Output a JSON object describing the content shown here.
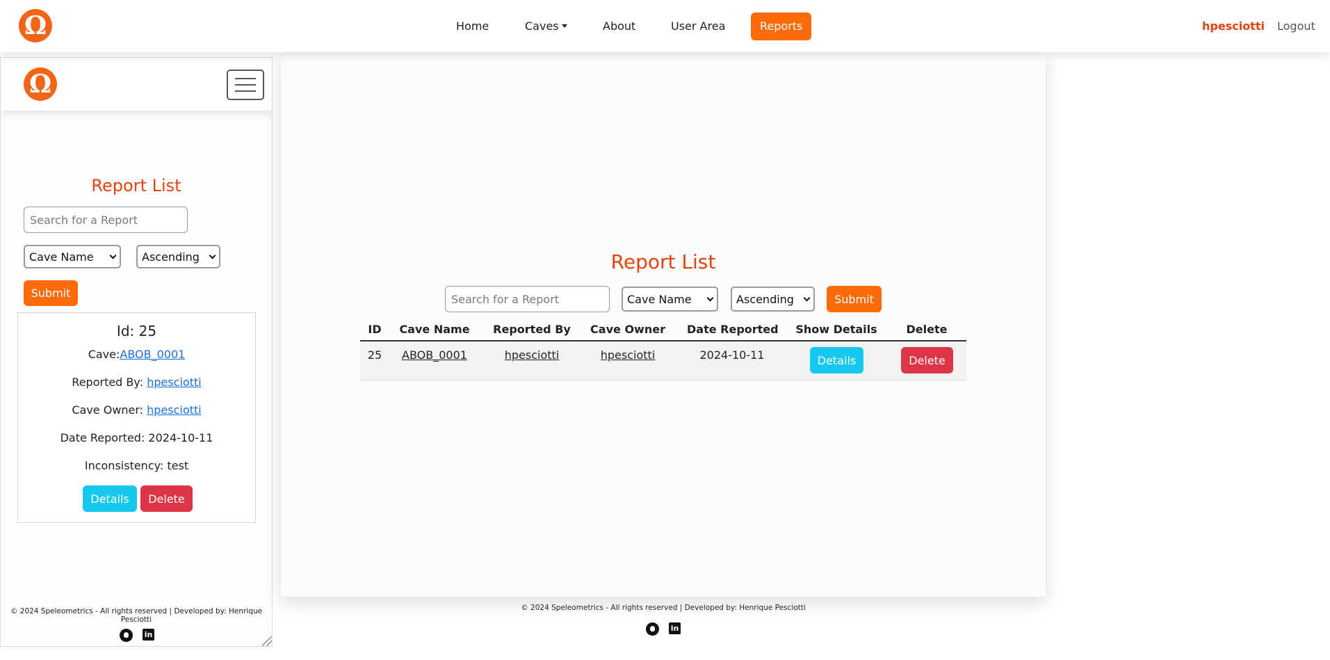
{
  "navbar": {
    "logo": "Ω",
    "links": [
      "Home",
      "Caves",
      "About",
      "User Area",
      "Reports"
    ],
    "active": "Reports",
    "username": "hpesciotti",
    "logout": "Logout"
  },
  "left_preview": {
    "logo": "Ω",
    "title": "Report List",
    "search_placeholder": "Search for a Report",
    "sort_field": "Cave Name",
    "sort_order": "Ascending",
    "submit": "Submit",
    "card": {
      "id_label": "Id: 25",
      "cave_label": "Cave:",
      "cave_value": "ABOB_0001",
      "reported_by_label": "Reported By: ",
      "reported_by_value": "hpesciotti",
      "owner_label": "Cave Owner: ",
      "owner_value": "hpesciotti",
      "date_line": "Date Reported: 2024-10-11",
      "inconsistency_line": "Inconsistency: test",
      "details": "Details",
      "delete": "Delete"
    },
    "footer": "© 2024 Speleometrics - All rights reserved | Developed by: Henrique Pesciotti"
  },
  "main": {
    "title": "Report List",
    "search_placeholder": "Search for a Report",
    "sort_field": "Cave Name",
    "sort_order": "Ascending",
    "submit": "Submit",
    "table": {
      "headers": [
        "ID",
        "Cave Name",
        "Reported By",
        "Cave Owner",
        "Date Reported",
        "Show Details",
        "Delete"
      ],
      "rows": [
        {
          "id": "25",
          "cave_name": "ABOB_0001",
          "reported_by": "hpesciotti",
          "cave_owner": "hpesciotti",
          "date_reported": "2024-10-11",
          "details": "Details",
          "delete": "Delete"
        }
      ]
    }
  },
  "footer": {
    "text": "© 2024 Speleometrics - All rights reserved | Developed by: Henrique Pesciotti",
    "icons": [
      "github-icon",
      "linkedin-icon"
    ]
  },
  "colors": {
    "brand_orange": "#fd6a0a",
    "title_red": "#e8420c",
    "info": "#16c8ee",
    "danger": "#dc3545",
    "link": "#1a6fe0"
  }
}
